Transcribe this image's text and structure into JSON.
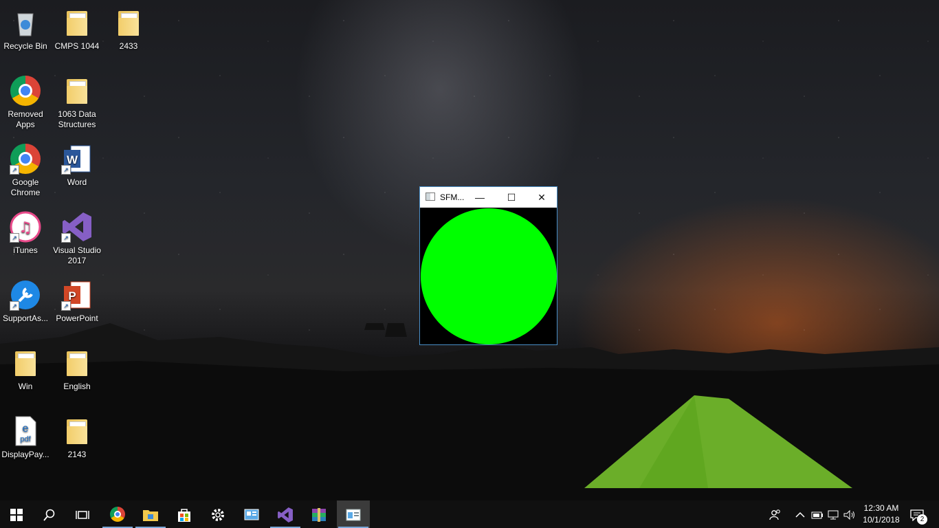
{
  "desktop": {
    "icons": [
      {
        "label": "Recycle Bin",
        "icon": "recycle-bin-icon"
      },
      {
        "label": "CMPS 1044",
        "icon": "folder-icon"
      },
      {
        "label": "2433",
        "icon": "folder-icon"
      },
      {
        "label": "Removed Apps",
        "icon": "chrome-icon"
      },
      {
        "label": "1063 Data Structures",
        "icon": "folder-icon"
      },
      {
        "label": "Google Chrome",
        "icon": "chrome-icon"
      },
      {
        "label": "Word",
        "icon": "word-icon"
      },
      {
        "label": "iTunes",
        "icon": "itunes-icon"
      },
      {
        "label": "Visual Studio 2017",
        "icon": "visual-studio-icon"
      },
      {
        "label": "SupportAs...",
        "icon": "support-assist-icon"
      },
      {
        "label": "PowerPoint",
        "icon": "powerpoint-icon"
      },
      {
        "label": "Win",
        "icon": "folder-icon"
      },
      {
        "label": "English",
        "icon": "folder-icon"
      },
      {
        "label": "DisplayPay...",
        "icon": "pdf-icon"
      },
      {
        "label": "2143",
        "icon": "folder-icon"
      }
    ]
  },
  "window": {
    "title": "SFM...",
    "minimize_glyph": "—",
    "maximize_glyph": "☐",
    "close_glyph": "✕",
    "circle_color": "#00ff00",
    "background_color": "#000000"
  },
  "taskbar": {
    "start_glyph": "⊞",
    "search_glyph": "⌕",
    "taskview_glyph": "◫",
    "apps": [
      {
        "name": "chrome",
        "icon": "chrome-icon"
      },
      {
        "name": "file-explorer",
        "icon": "folder-icon"
      },
      {
        "name": "store",
        "icon": "store-icon"
      },
      {
        "name": "settings",
        "icon": "gear-icon"
      },
      {
        "name": "control-panel",
        "icon": "control-panel-icon"
      },
      {
        "name": "visual-studio",
        "icon": "visual-studio-icon"
      },
      {
        "name": "winrar",
        "icon": "winrar-icon"
      },
      {
        "name": "sfml-app",
        "icon": "app-window-icon"
      }
    ],
    "clock_time": "12:30 AM",
    "clock_date": "10/1/2018",
    "notification_count": "2"
  }
}
